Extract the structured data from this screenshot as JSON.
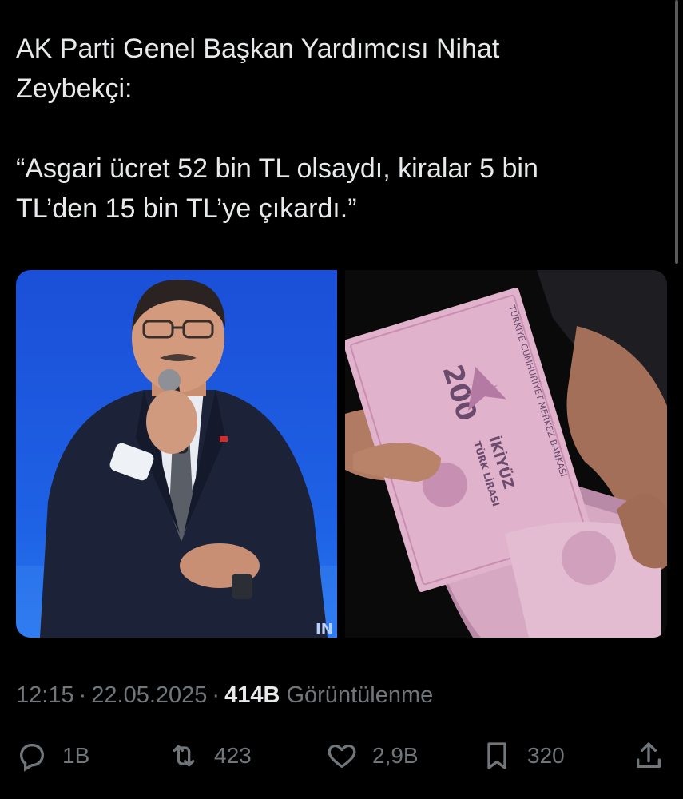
{
  "tweet": {
    "line1": "AK Parti Genel Başkan Yardımcısı Nihat",
    "line2": "Zeybekçi:",
    "quote_line1": "“Asgari ücret 52 bin TL olsaydı, kiralar 5 bin",
    "quote_line2": "TL’den 15 bin TL’ye çıkardı.”"
  },
  "media": {
    "banknote_value": "200",
    "banknote_text": "İKİYÜZ",
    "banknote_currency": "TÜRK LİRASI",
    "bank_name": "TÜRKİYE CUMHURİYET MERKEZ BANKASI",
    "logo_text": "IN"
  },
  "meta": {
    "time": "12:15",
    "separator": "·",
    "date": "22.05.2025",
    "views_count": "414B",
    "views_label": "Görüntülenme"
  },
  "actions": {
    "reply_count": "1B",
    "retweet_count": "423",
    "like_count": "2,9B",
    "bookmark_count": "320"
  },
  "icons": [
    "reply-icon",
    "retweet-icon",
    "heart-icon",
    "bookmark-icon",
    "share-icon"
  ],
  "colors": {
    "background": "#000000",
    "text": "#e7e9ea",
    "muted": "#71767b",
    "photo_blue": "#1e5fe0",
    "banknote_pink": "#d8a2bf"
  }
}
